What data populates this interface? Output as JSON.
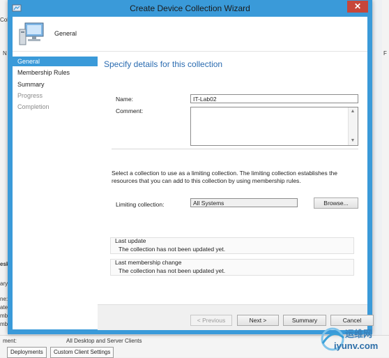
{
  "window": {
    "title": "Create Device Collection Wizard",
    "close_glyph": "✕"
  },
  "header": {
    "page_title": "General"
  },
  "nav": {
    "items": [
      {
        "label": "General",
        "state": "active"
      },
      {
        "label": "Membership Rules",
        "state": "enabled"
      },
      {
        "label": "Summary",
        "state": "enabled"
      },
      {
        "label": "Progress",
        "state": "disabled"
      },
      {
        "label": "Completion",
        "state": "disabled"
      }
    ]
  },
  "content": {
    "heading": "Specify details for this collection",
    "name_label": "Name:",
    "name_value": "IT-Lab02",
    "comment_label": "Comment:",
    "comment_value": "",
    "limiting_description": "Select a collection to use as a limiting collection. The limiting collection establishes the resources that you can add to this collection by using membership rules.",
    "limiting_label": "Limiting collection:",
    "limiting_value": "All Systems",
    "browse_label": "Browse...",
    "last_update_title": "Last update",
    "last_update_text": "The collection has not been updated yet.",
    "last_membership_title": "Last membership change",
    "last_membership_text": "The collection has not been updated yet."
  },
  "footer": {
    "previous_label": "< Previous",
    "next_label": "Next >",
    "summary_label": "Summary",
    "cancel_label": "Cancel"
  },
  "background": {
    "fragment_left_1": "Col",
    "fragment_left_2": "N",
    "fragment_left_3": "esk",
    "fragment_left_4": "ary",
    "fragment_left_5": "ne:",
    "fragment_left_6": "ate",
    "fragment_left_7": "mbe",
    "fragment_left_8": "mbe",
    "fragment_right": "F",
    "bottom_label": "ment:",
    "bottom_value": "All Desktop and Server Clients",
    "tab_deployments": "Deployments",
    "tab_custom_client": "Custom Client Settings"
  },
  "watermark": {
    "text_cn": "运维网",
    "text_en": "iyunv.com"
  },
  "colors": {
    "accent": "#3a9ad9",
    "heading": "#2a6bb0",
    "close": "#c7463a"
  }
}
